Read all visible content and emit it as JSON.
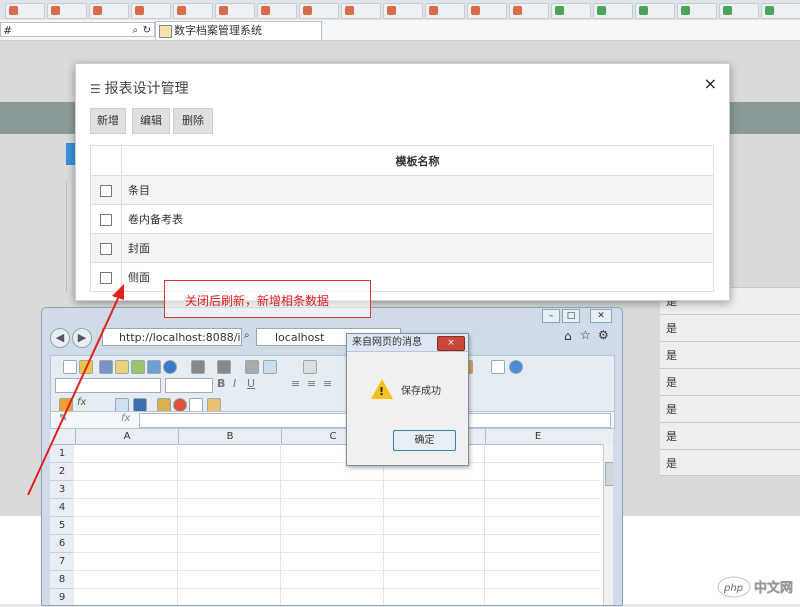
{
  "browser": {
    "address_text": "#",
    "tab_title": "数字档案管理系统"
  },
  "modal": {
    "title": "报表设计管理",
    "buttons": {
      "add": "新增",
      "edit": "编辑",
      "delete": "删除"
    },
    "table": {
      "header": "模板名称",
      "rows": [
        "条目",
        "卷内备考表",
        "封面",
        "侧面"
      ]
    }
  },
  "background_table": {
    "cells": [
      "是",
      "是",
      "是",
      "是",
      "是",
      "是",
      "是"
    ]
  },
  "annotation": {
    "text": "关闭后刷新，新增相条数据",
    "color": "#e02020"
  },
  "ie_window": {
    "address": "http://localhost:8088/i",
    "tab_title": "localhost",
    "fx_label": "fx",
    "columns": [
      "A",
      "B",
      "C",
      "D",
      "E"
    ],
    "rows": [
      "1",
      "2",
      "3",
      "4",
      "5",
      "6",
      "7",
      "8",
      "9"
    ]
  },
  "alert": {
    "title": "来自网页的消息",
    "message": "保存成功",
    "ok_label": "确定",
    "close_label": "×"
  },
  "watermark": {
    "text": "php 中文网"
  }
}
